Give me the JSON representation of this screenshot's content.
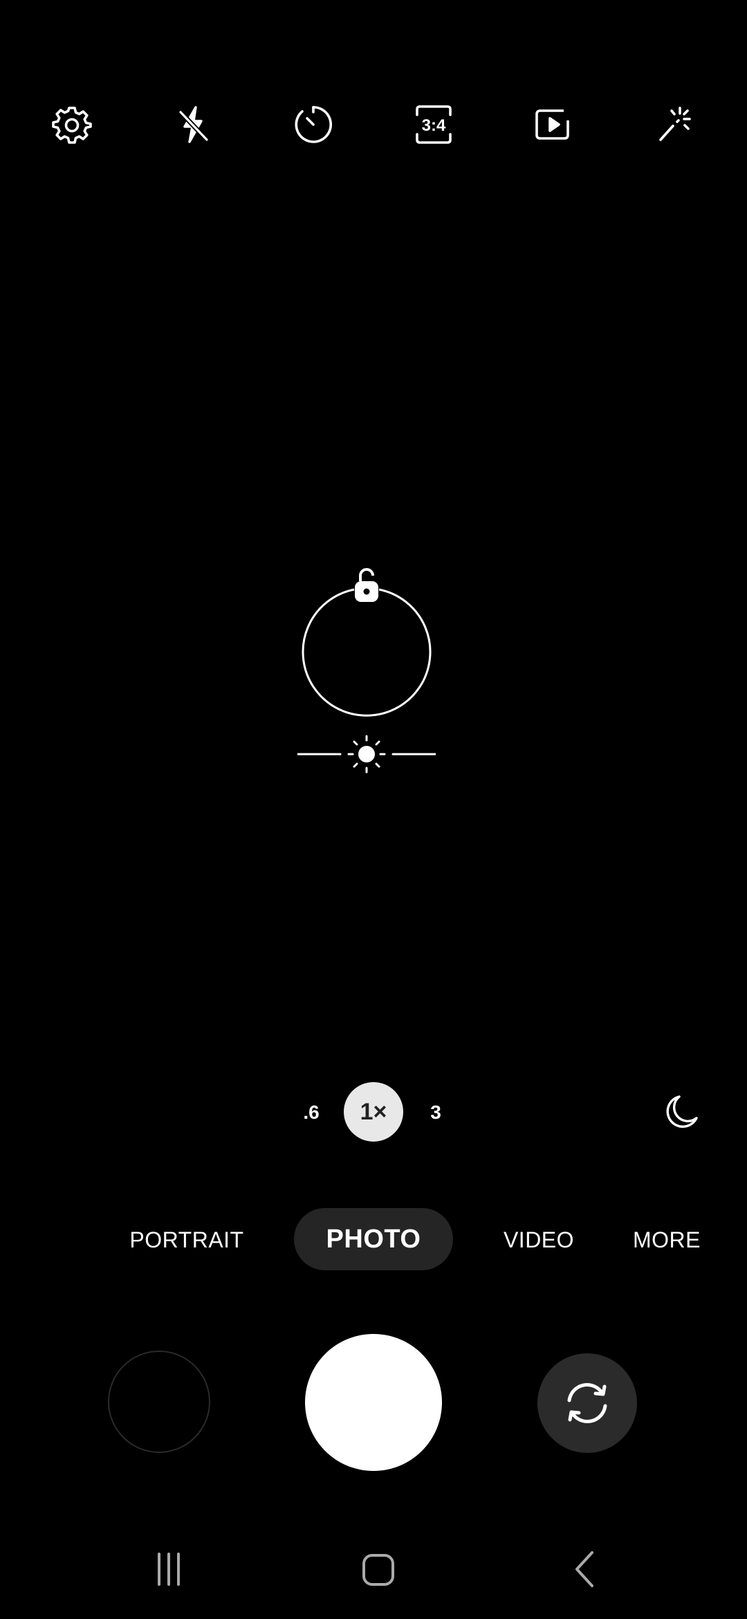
{
  "toolbar": {
    "icons": [
      "gear-icon",
      "flash-off-icon",
      "timer-icon",
      "aspect-ratio-icon",
      "motion-photo-icon",
      "filters-icon"
    ],
    "aspect_ratio_label": "3:4"
  },
  "viewfinder": {
    "focus_lock_state": "unlocked",
    "icons": [
      "padlock-open-icon",
      "brightness-icon"
    ]
  },
  "zoom": {
    "options": [
      ".6",
      "1×",
      "3"
    ],
    "selected": "1×"
  },
  "night_mode": {
    "icon": "moon-icon"
  },
  "modes": {
    "items": [
      "PORTRAIT",
      "PHOTO",
      "VIDEO",
      "MORE"
    ],
    "selected": "PHOTO"
  },
  "controls": {
    "icons": [
      "gallery-thumbnail",
      "shutter-button",
      "switch-camera-icon"
    ]
  },
  "navbar": {
    "icons": [
      "recent-apps-icon",
      "home-icon",
      "back-icon"
    ]
  },
  "colors": {
    "background": "#000000",
    "foreground": "#ffffff",
    "active_pill": "#252525",
    "zoom_active_bg": "#e8e8e8",
    "switch_button_bg": "#2b2b2b"
  }
}
